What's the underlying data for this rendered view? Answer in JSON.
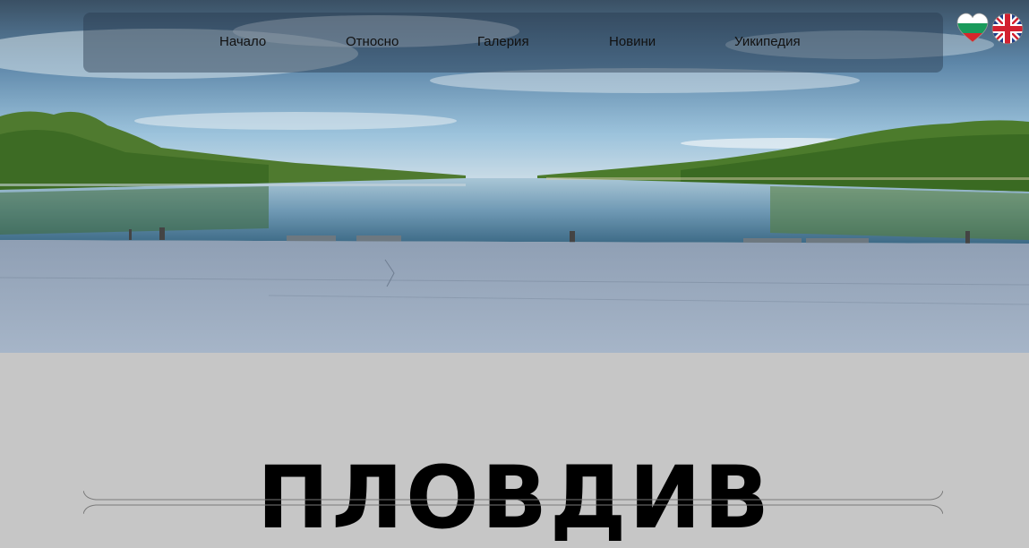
{
  "nav": {
    "items": [
      {
        "label": "Начало"
      },
      {
        "label": "Относно"
      },
      {
        "label": "Галерия"
      },
      {
        "label": "Новини"
      },
      {
        "label": "Уикипедия"
      }
    ]
  },
  "language": {
    "flags": [
      {
        "icon": "bulgarian-flag-heart-icon"
      },
      {
        "icon": "uk-flag-icon"
      }
    ]
  },
  "hero": {
    "image": "rowing-canal-landscape"
  },
  "main": {
    "title": "ПЛОВДИВ"
  },
  "colors": {
    "page_background": "#c6c6c6",
    "nav_background": "rgba(40,58,78,0.45)",
    "text": "#111111"
  }
}
